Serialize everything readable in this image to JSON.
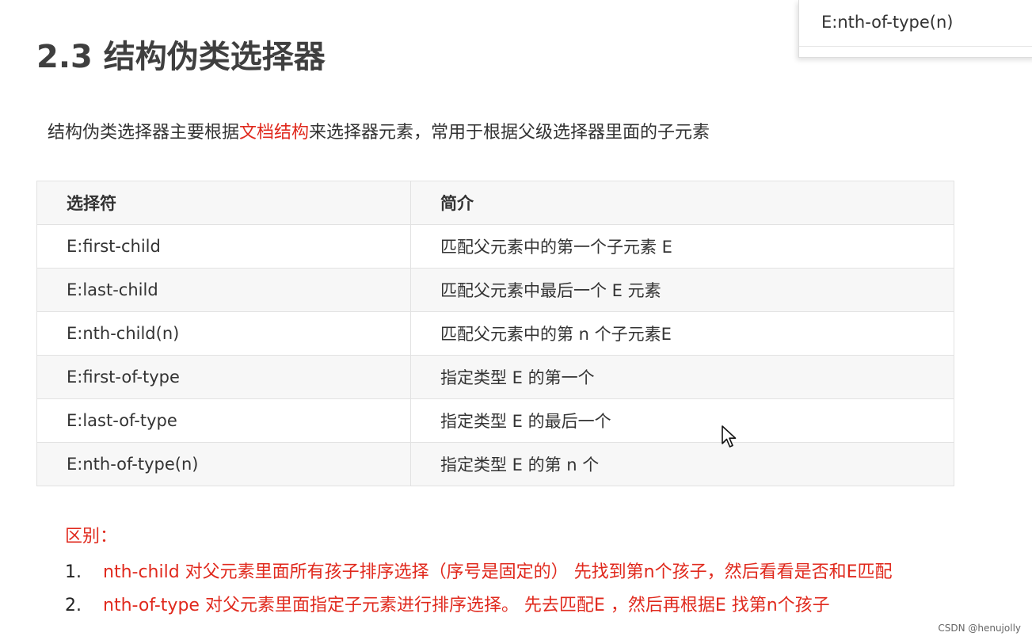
{
  "title": "2.3 结构伪类选择器",
  "intro": {
    "before": "结构伪类选择器主要根据",
    "highlight": "文档结构",
    "after": "来选择器元素，常用于根据父级选择器里面的子元素"
  },
  "table": {
    "headers": [
      "选择符",
      "简介"
    ],
    "rows": [
      {
        "selector": "E:first-child",
        "description": "匹配父元素中的第一个子元素 E"
      },
      {
        "selector": "E:last-child",
        "description": "匹配父元素中最后一个 E 元素"
      },
      {
        "selector": "E:nth-child(n)",
        "description": "匹配父元素中的第 n 个子元素E"
      },
      {
        "selector": "E:first-of-type",
        "description": "指定类型 E 的第一个"
      },
      {
        "selector": "E:last-of-type",
        "description": "指定类型 E 的最后一个"
      },
      {
        "selector": "E:nth-of-type(n)",
        "description": "指定类型 E 的第 n 个"
      }
    ]
  },
  "difference": {
    "title": "区别：",
    "items": [
      {
        "number": "1.",
        "text": "nth-child 对父元素里面所有孩子排序选择（序号是固定的） 先找到第n个孩子，然后看看是否和E匹配"
      },
      {
        "number": "2.",
        "text": "nth-of-type 对父元素里面指定子元素进行排序选择。 先去匹配E ，然后再根据E 找第n个孩子"
      }
    ]
  },
  "popup": {
    "item": "E:nth-of-type(n)"
  },
  "watermark": "CSDN @henujolly",
  "colors": {
    "highlight": "#e0291d",
    "header_bg": "#f7f7f7",
    "border": "#e2e2e2"
  },
  "icons": {
    "cursor": "mouse-pointer-icon"
  }
}
